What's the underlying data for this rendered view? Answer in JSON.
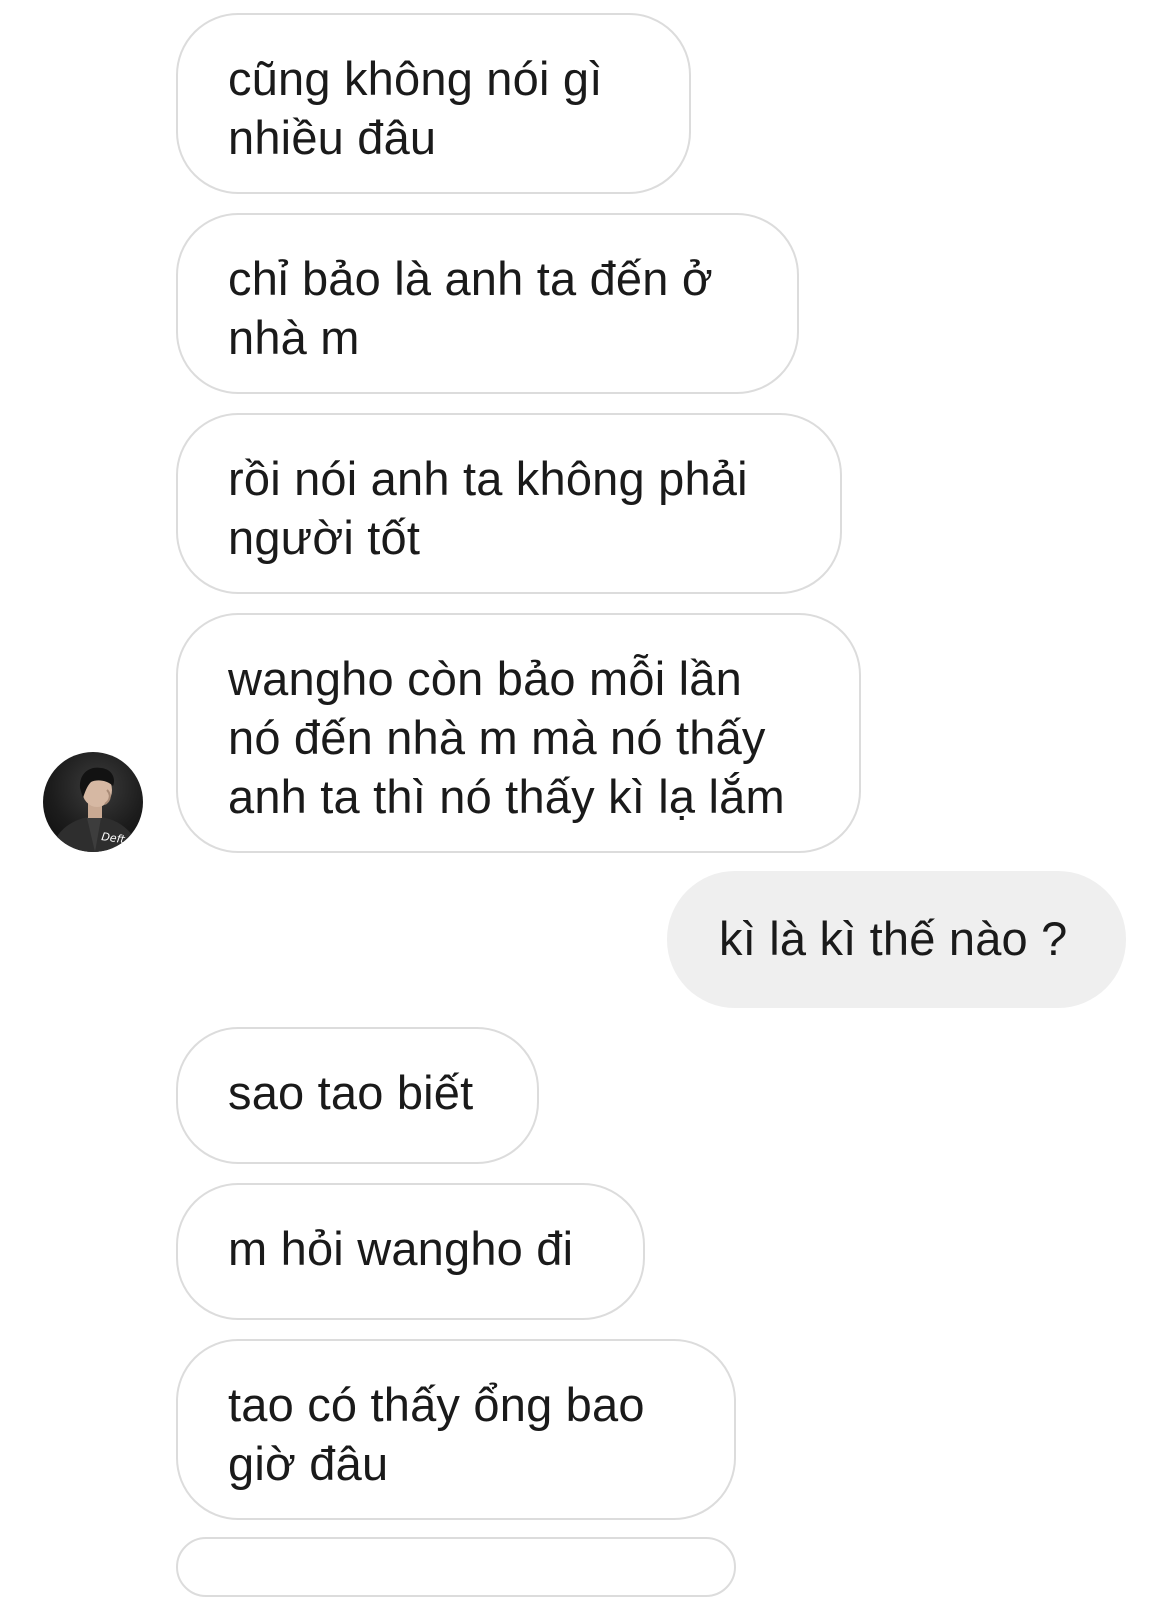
{
  "chat": {
    "messages": [
      {
        "sender": "other",
        "text": "cũng không nói gì\nnhiều đâu"
      },
      {
        "sender": "other",
        "text": "chỉ bảo là anh ta đến ở\nnhà m"
      },
      {
        "sender": "other",
        "text": "rồi nói anh ta không phải\nngười tốt"
      },
      {
        "sender": "other",
        "text": "wangho còn bảo mỗi lần\nnó đến nhà m mà nó thấy\nanh ta thì nó thấy kì lạ lắm"
      },
      {
        "sender": "me",
        "text": "kì là kì thế nào ?"
      },
      {
        "sender": "other",
        "text": "sao tao biết"
      },
      {
        "sender": "other",
        "text": "m hỏi wangho đi"
      },
      {
        "sender": "other",
        "text": "tao có thấy ổng bao\ngiờ đâu"
      }
    ],
    "avatar": {
      "icon": "profile-photo",
      "caption": "Deft"
    }
  }
}
